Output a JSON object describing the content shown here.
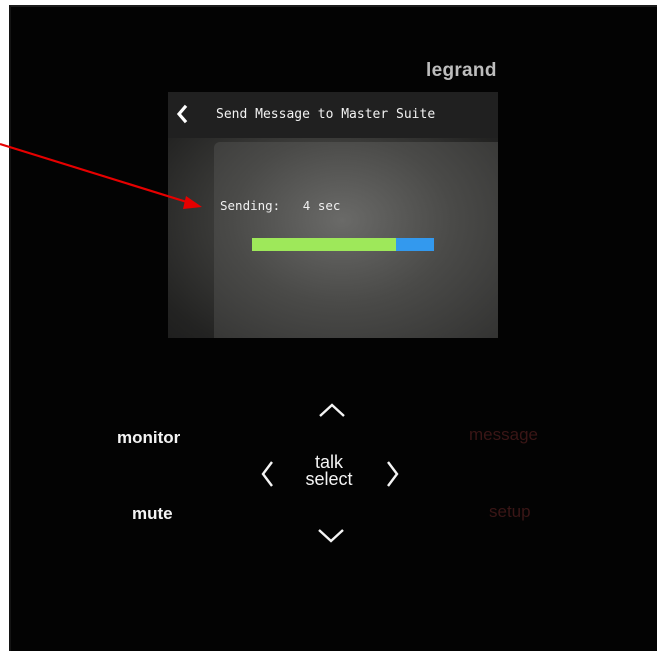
{
  "device": {
    "brand": "legrand"
  },
  "screen": {
    "title": "Send Message to Master Suite",
    "back_icon": "chevron-left-icon",
    "status_label": "Sending:   4 sec",
    "progress_fraction": 0.79,
    "colors": {
      "progress_fill": "#9ee85a",
      "progress_remaining": "#3399ee"
    }
  },
  "keypad": {
    "monitor": "monitor",
    "mute": "mute",
    "message": "message",
    "setup": "setup",
    "talk": "talk",
    "select": "select",
    "up_icon": "chevron-up-icon",
    "down_icon": "chevron-down-icon",
    "left_icon": "chevron-left-icon",
    "right_icon": "chevron-right-icon"
  },
  "annotation": {
    "color": "#e60000"
  }
}
